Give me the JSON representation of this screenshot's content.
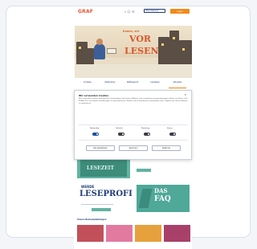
{
  "header": {
    "logo_text": "GRAF",
    "icon_glyphs": "⌕ ☺ ☰",
    "select_value": "Bundesland",
    "cta_label": "Login"
  },
  "hero": {
    "kicker": "Komm, wir",
    "word1": "VOR",
    "word2": "LESEN"
  },
  "nav": {
    "items": [
      "Vorlesen",
      "Materialien",
      "Wettbewerb",
      "Lesetipps",
      "Aktuelles"
    ]
  },
  "cookie": {
    "title": "Wir verwenden Cookies",
    "text": "Wir verwenden Cookies und ähnliche Technologien auf unserer Website und verarbeiten personenbezogene Daten von Ihnen (z.B. IP-Adresse), um Inhalte und Anzeigen zu personalisieren, Medien von Drittanbietern einzubinden oder Zugriffe auf unsere Website zu analysieren.",
    "toggles": [
      "Notwendig",
      "Statistik",
      "Marketing",
      "Extern"
    ],
    "buttons": [
      "Alle akzeptieren",
      "Speichern",
      "Ablehnen"
    ]
  },
  "content": {
    "tile_a_text": "LESEZEIT",
    "tile_b_text": "Jetzt mitmachen beim Vorlese-Wettbewerb",
    "lese_l1": "WERDE",
    "lese_l2": "LESEPROFI",
    "faq_l1": "DAS",
    "faq_l2": "FAQ",
    "recommendations_title": "Unsere Buchempfehlungen"
  },
  "colors": {
    "accent_orange": "#f08a1c",
    "brand_red": "#e8532f",
    "navy": "#1f3b7a",
    "teal": "#63b3a3"
  }
}
